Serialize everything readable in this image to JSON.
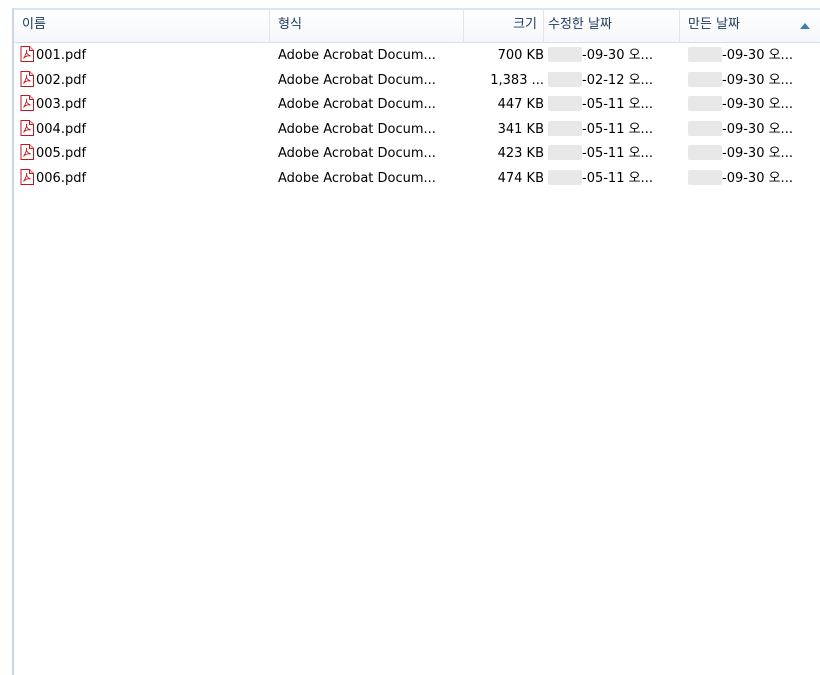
{
  "columns": {
    "name": "이름",
    "type": "형식",
    "size": "크기",
    "modified": "수정한 날짜",
    "created": "만든 날짜"
  },
  "sort": {
    "column": "created",
    "direction": "ascending",
    "icon": "sort-ascending-icon"
  },
  "rows": [
    {
      "icon": "pdf-file-icon",
      "name": "001.pdf",
      "type": "Adobe Acrobat Docum...",
      "size": "700 KB",
      "modified": "-09-30 오...",
      "created": "-09-30 오..."
    },
    {
      "icon": "pdf-file-icon",
      "name": "002.pdf",
      "type": "Adobe Acrobat Docum...",
      "size": "1,383 ...",
      "modified": "-02-12 오...",
      "created": "-09-30 오..."
    },
    {
      "icon": "pdf-file-icon",
      "name": "003.pdf",
      "type": "Adobe Acrobat Docum...",
      "size": "447 KB",
      "modified": "-05-11 오...",
      "created": "-09-30 오..."
    },
    {
      "icon": "pdf-file-icon",
      "name": "004.pdf",
      "type": "Adobe Acrobat Docum...",
      "size": "341 KB",
      "modified": "-05-11 오...",
      "created": "-09-30 오..."
    },
    {
      "icon": "pdf-file-icon",
      "name": "005.pdf",
      "type": "Adobe Acrobat Docum...",
      "size": "423 KB",
      "modified": "-05-11 오...",
      "created": "-09-30 오..."
    },
    {
      "icon": "pdf-file-icon",
      "name": "006.pdf",
      "type": "Adobe Acrobat Docum...",
      "size": "474 KB",
      "modified": "-05-11 오...",
      "created": "-09-30 오..."
    }
  ],
  "colors": {
    "header_text": "#1e395b",
    "sort_arrow": "#3c7fb1",
    "pdf_red": "#c4161c"
  }
}
